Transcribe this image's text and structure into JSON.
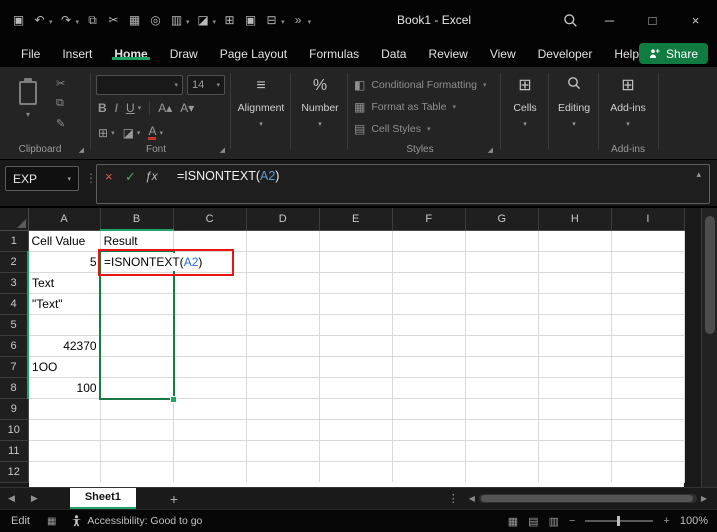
{
  "colors": {
    "accent_green": "#21A366",
    "share_green": "#107C41",
    "header_fill_orange": "#ED7D31",
    "input_fill_green": "#D6E4BC",
    "result_fill_green": "#A9BB8C",
    "reference_blue": "#2B6CD4",
    "formula_ref_blue": "#5B9BD5",
    "annotation_red": "#E81416"
  },
  "titlebar": {
    "title": "Book1 - Excel",
    "qat": [
      {
        "name": "save-icon",
        "glyph": "▣"
      },
      {
        "name": "undo-icon",
        "glyph": "↶",
        "caret": true
      },
      {
        "name": "redo-icon",
        "glyph": "↷",
        "caret": true
      },
      {
        "name": "copy-icon",
        "glyph": "⧉"
      },
      {
        "name": "cut-icon",
        "glyph": "✂"
      },
      {
        "name": "picture-icon",
        "glyph": "▦"
      },
      {
        "name": "zoom-icon",
        "glyph": "◎"
      },
      {
        "name": "chart-icon",
        "glyph": "▥",
        "caret": true
      },
      {
        "name": "format-painter-icon",
        "glyph": "◪",
        "caret": true
      },
      {
        "name": "table-icon",
        "glyph": "⊞"
      },
      {
        "name": "camera-icon",
        "glyph": "▣"
      },
      {
        "name": "borders-icon",
        "glyph": "⊟",
        "caret": true
      },
      {
        "name": "qat-overflow-icon",
        "glyph": "»",
        "caret": true
      }
    ],
    "window_controls": {
      "minimize": "─",
      "maximize": "□",
      "close": "×"
    }
  },
  "menubar": {
    "items": [
      "File",
      "Insert",
      "Home",
      "Draw",
      "Page Layout",
      "Formulas",
      "Data",
      "Review",
      "View",
      "Developer",
      "Help"
    ],
    "active_index": 2,
    "share_label": "Share"
  },
  "ribbon": {
    "font_size": "14",
    "groups": {
      "clipboard": "Clipboard",
      "font": "Font",
      "alignment": "Alignment",
      "number": "Number",
      "styles": "Styles",
      "cells": "Cells",
      "editing": "Editing",
      "addins": "Add-ins"
    },
    "styles_items": [
      "Conditional Formatting",
      "Format as Table",
      "Cell Styles"
    ]
  },
  "formula_bar": {
    "name_box": "EXP",
    "cancel": "×",
    "enter": "✓",
    "fx": "ƒx",
    "prefix": "=ISNONTEXT(",
    "ref": "A2",
    "suffix": ")"
  },
  "grid": {
    "columns": [
      "A",
      "B",
      "C",
      "D",
      "E",
      "F",
      "G",
      "H",
      "I"
    ],
    "row_count": 12,
    "cells": [
      {
        "ref": "A1",
        "text": "Cell Value",
        "bg": "orange"
      },
      {
        "ref": "B1",
        "text": "Result",
        "bg": "orange"
      },
      {
        "ref": "A2",
        "text": "5",
        "bg": "lightgreen",
        "align": "right"
      },
      {
        "ref": "B2",
        "text": "",
        "bg": "white"
      },
      {
        "ref": "A3",
        "text": "Text",
        "bg": "lightgreen"
      },
      {
        "ref": "B3",
        "bg": "selgreen"
      },
      {
        "ref": "A4",
        "text": "\"Text\"",
        "bg": "lightgreen"
      },
      {
        "ref": "B4",
        "bg": "selgreen"
      },
      {
        "ref": "A5",
        "text": "",
        "bg": "lightgreen"
      },
      {
        "ref": "B5",
        "bg": "selgreen"
      },
      {
        "ref": "A6",
        "text": "42370",
        "bg": "lightgreen",
        "align": "right"
      },
      {
        "ref": "B6",
        "bg": "selgreen"
      },
      {
        "ref": "A7",
        "text": "1OO",
        "bg": "lightgreen"
      },
      {
        "ref": "B7",
        "bg": "selgreen"
      },
      {
        "ref": "A8",
        "text": "100",
        "bg": "lightgreen",
        "align": "right"
      },
      {
        "ref": "B8",
        "bg": "selgreen"
      }
    ],
    "edit_cell": {
      "ref": "B2",
      "prefix": "=ISNONTEXT(",
      "ref_text": "A2",
      "suffix": ")"
    }
  },
  "sheet_tabs": {
    "active": "Sheet1",
    "add": "+"
  },
  "statusbar": {
    "mode": "Edit",
    "accessibility": "Accessibility: Good to go",
    "zoom": "100%"
  },
  "icons": {
    "caret": "▾",
    "cut": "✂",
    "copy": "⧉",
    "format_painter": "✎",
    "bold": "B",
    "italic": "I",
    "underline": "U",
    "grow_font": "A▴",
    "shrink_font": "A▾",
    "borders": "⊞",
    "fill_color": "◪",
    "font_color": "A",
    "alignment": "≡",
    "percent": "%",
    "conditional_formatting": "◧",
    "format_table": "▦",
    "cell_styles": "▤",
    "cells": "⊞",
    "addins": "⊞",
    "launcher": "◢",
    "dots": "⋮",
    "arrow_left": "◀",
    "arrow_right": "▶",
    "chev_up": "▴",
    "minus": "−",
    "plus": "+",
    "view_normal": "▦",
    "view_layout": "▤",
    "view_break": "▥",
    "macro": "▦"
  }
}
